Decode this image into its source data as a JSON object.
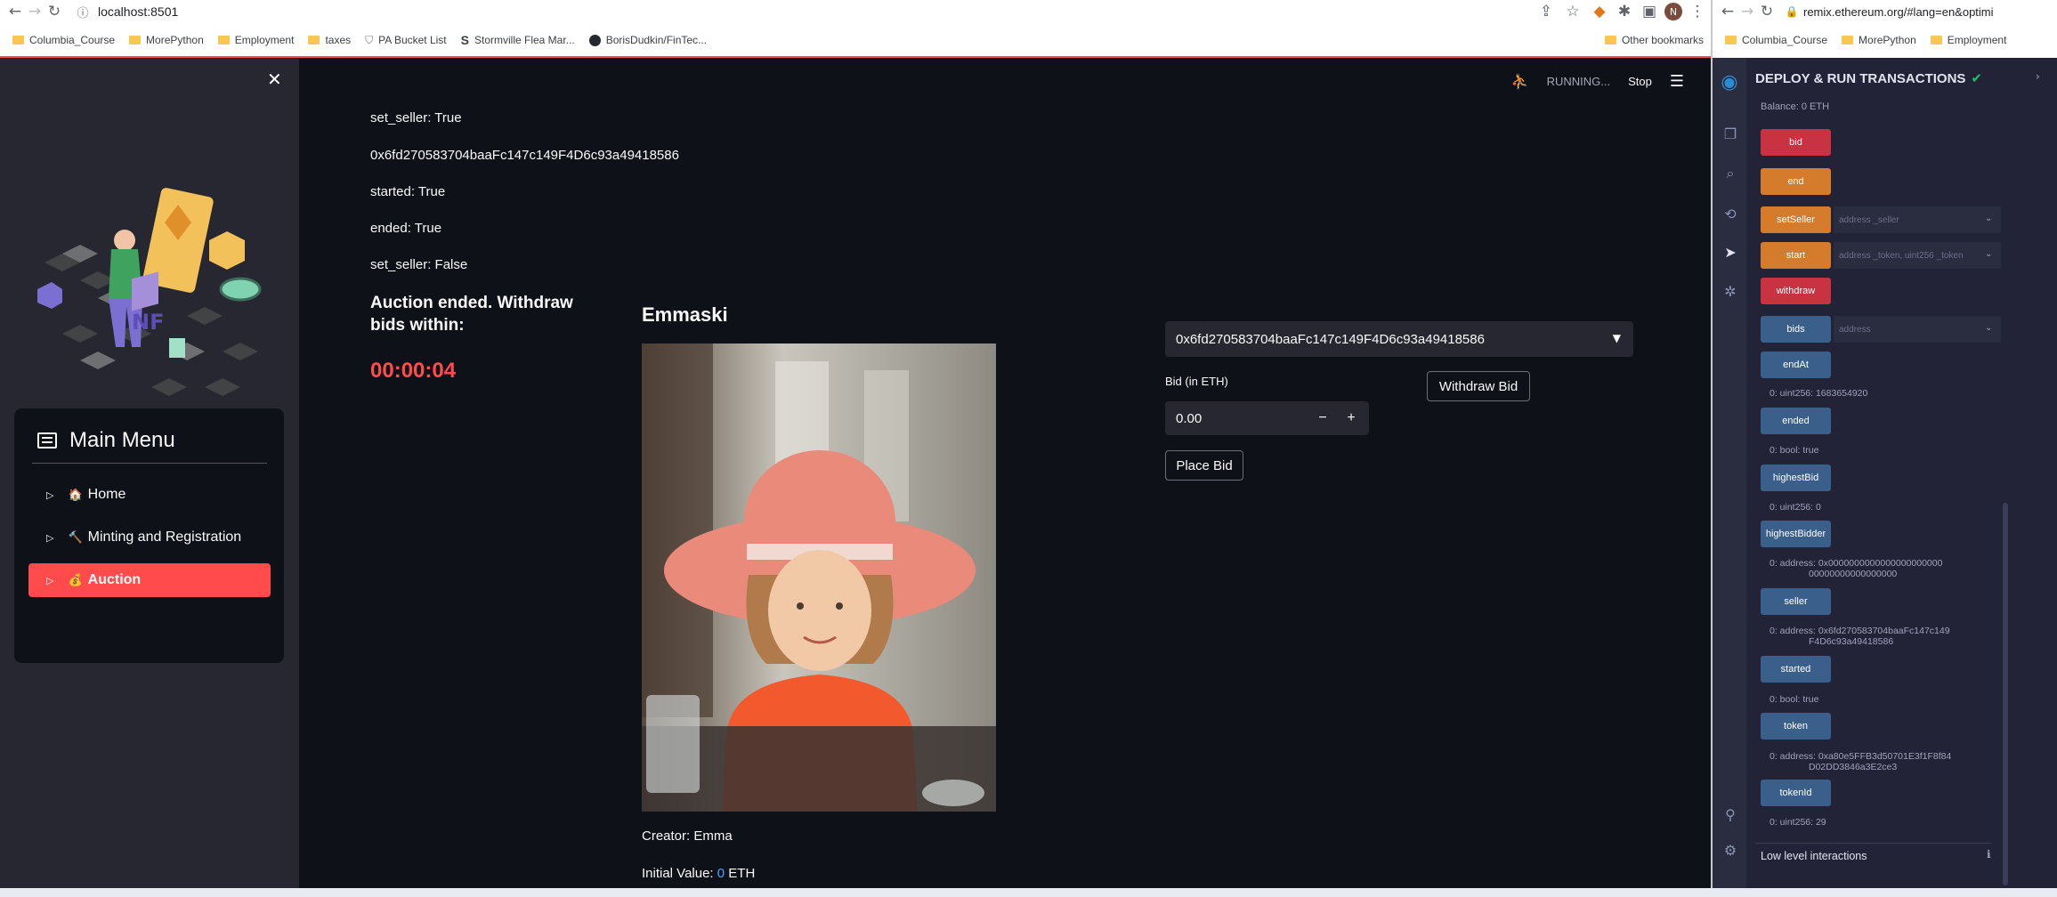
{
  "browser_left": {
    "url": "localhost:8501",
    "bookmarks": [
      "Columbia_Course",
      "MorePython",
      "Employment",
      "taxes",
      "PA Bucket List",
      "Stormville Flea Mar...",
      "BorisDudkin/FinTec..."
    ],
    "other_bookmarks": "Other bookmarks",
    "profile_initial": "N"
  },
  "app": {
    "status": "RUNNING...",
    "stop_label": "Stop",
    "menu": {
      "title": "Main Menu",
      "items": [
        {
          "label": "Home",
          "icon": "🏠"
        },
        {
          "label": "Minting and Registration",
          "icon": "🔨"
        },
        {
          "label": "Auction",
          "icon": "💰"
        }
      ]
    },
    "status_lines": [
      "set_seller: True",
      "0x6fd270583704baaFc147c149F4D6c93a49418586",
      "started: True",
      "ended: True",
      "set_seller: False"
    ],
    "auction_heading": "Auction ended. Withdraw bids within:",
    "timer": "00:00:04",
    "artwork_title": "Emmaski",
    "creator": "Creator: Emma",
    "initial_value_label": "Initial Value:",
    "initial_value": "0",
    "initial_value_unit": "ETH",
    "account_select": "0x6fd270583704baaFc147c149F4D6c93a49418586",
    "bid_label": "Bid (in ETH)",
    "bid_value": "0.00",
    "minus": "−",
    "plus": "+",
    "withdraw_label": "Withdraw Bid",
    "place_bid_label": "Place Bid"
  },
  "browser_right": {
    "url": "remix.ethereum.org/#lang=en&optimi",
    "bookmarks": [
      "Columbia_Course",
      "MorePython",
      "Employment"
    ]
  },
  "remix": {
    "header": "DEPLOY & RUN TRANSACTIONS",
    "balance": "Balance: 0 ETH",
    "functions": [
      {
        "label": "bid",
        "color": "red"
      },
      {
        "label": "end",
        "color": "org"
      },
      {
        "label": "setSeller",
        "color": "org",
        "placeholder": "address _seller"
      },
      {
        "label": "start",
        "color": "org",
        "placeholder": "address _token, uint256 _token"
      },
      {
        "label": "withdraw",
        "color": "red"
      },
      {
        "label": "bids",
        "color": "blu",
        "placeholder": "address"
      },
      {
        "label": "endAt",
        "color": "blu",
        "output": "0: uint256: 1683654920"
      },
      {
        "label": "ended",
        "color": "blu",
        "output": "0: bool: true"
      },
      {
        "label": "highestBid",
        "color": "blu",
        "output": "0: uint256: 0"
      },
      {
        "label": "highestBidder",
        "color": "blu",
        "output": "0:  address: 0x0000000000000000000000",
        "output2": "00000000000000000"
      },
      {
        "label": "seller",
        "color": "blu",
        "output": "0:  address: 0x6fd270583704baaFc147c149",
        "output2": "F4D6c93a49418586"
      },
      {
        "label": "started",
        "color": "blu",
        "output": "0: bool: true"
      },
      {
        "label": "token",
        "color": "blu",
        "output": "0:  address: 0xa80e5FFB3d50701E3f1F8f84",
        "output2": "D02DD3846a3E2ce3"
      },
      {
        "label": "tokenId",
        "color": "blu",
        "output": "0: uint256: 29"
      }
    ],
    "low_level": "Low level interactions"
  }
}
